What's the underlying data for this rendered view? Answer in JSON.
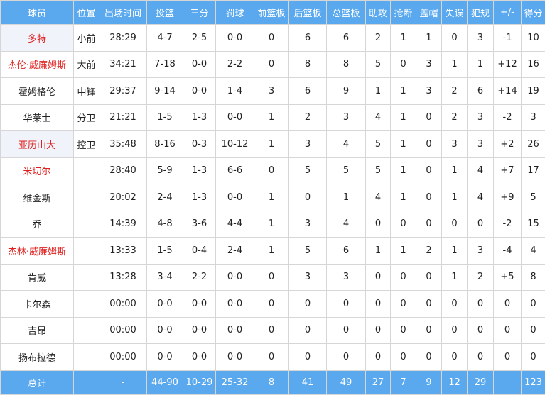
{
  "headers": [
    "球员",
    "位置",
    "出场时间",
    "投篮",
    "三分",
    "罚球",
    "前篮板",
    "后篮板",
    "总篮板",
    "助攻",
    "抢断",
    "盖帽",
    "失误",
    "犯规",
    "+/-",
    "得分"
  ],
  "players": [
    {
      "name": "多特",
      "pos": "小前",
      "min": "28:29",
      "fg": "4-7",
      "tp": "2-5",
      "ft": "0-0",
      "oreb": "0",
      "dreb": "6",
      "reb": "6",
      "ast": "2",
      "stl": "1",
      "blk": "1",
      "tov": "0",
      "pf": "3",
      "pm": "-1",
      "pts": "10",
      "red": true,
      "hl": true
    },
    {
      "name": "杰伦·威廉姆斯",
      "pos": "大前",
      "min": "34:21",
      "fg": "7-18",
      "tp": "0-0",
      "ft": "2-2",
      "oreb": "0",
      "dreb": "8",
      "reb": "8",
      "ast": "5",
      "stl": "0",
      "blk": "3",
      "tov": "1",
      "pf": "1",
      "pm": "+12",
      "pts": "16",
      "red": true,
      "hl": false
    },
    {
      "name": "霍姆格伦",
      "pos": "中锋",
      "min": "29:37",
      "fg": "9-14",
      "tp": "0-0",
      "ft": "1-4",
      "oreb": "3",
      "dreb": "6",
      "reb": "9",
      "ast": "1",
      "stl": "1",
      "blk": "3",
      "tov": "2",
      "pf": "6",
      "pm": "+14",
      "pts": "19",
      "red": false,
      "hl": false
    },
    {
      "name": "华莱士",
      "pos": "分卫",
      "min": "21:21",
      "fg": "1-5",
      "tp": "1-3",
      "ft": "0-0",
      "oreb": "1",
      "dreb": "2",
      "reb": "3",
      "ast": "4",
      "stl": "1",
      "blk": "0",
      "tov": "2",
      "pf": "3",
      "pm": "-2",
      "pts": "3",
      "red": false,
      "hl": false
    },
    {
      "name": "亚历山大",
      "pos": "控卫",
      "min": "35:48",
      "fg": "8-16",
      "tp": "0-3",
      "ft": "10-12",
      "oreb": "1",
      "dreb": "3",
      "reb": "4",
      "ast": "5",
      "stl": "1",
      "blk": "0",
      "tov": "3",
      "pf": "3",
      "pm": "+2",
      "pts": "26",
      "red": true,
      "hl": true
    },
    {
      "name": "米切尔",
      "pos": "",
      "min": "28:40",
      "fg": "5-9",
      "tp": "1-3",
      "ft": "6-6",
      "oreb": "0",
      "dreb": "5",
      "reb": "5",
      "ast": "5",
      "stl": "1",
      "blk": "0",
      "tov": "1",
      "pf": "4",
      "pm": "+7",
      "pts": "17",
      "red": true,
      "hl": false
    },
    {
      "name": "维金斯",
      "pos": "",
      "min": "20:02",
      "fg": "2-4",
      "tp": "1-3",
      "ft": "0-0",
      "oreb": "1",
      "dreb": "0",
      "reb": "1",
      "ast": "4",
      "stl": "1",
      "blk": "0",
      "tov": "1",
      "pf": "4",
      "pm": "+9",
      "pts": "5",
      "red": false,
      "hl": false
    },
    {
      "name": "乔",
      "pos": "",
      "min": "14:39",
      "fg": "4-8",
      "tp": "3-6",
      "ft": "4-4",
      "oreb": "1",
      "dreb": "3",
      "reb": "4",
      "ast": "0",
      "stl": "0",
      "blk": "0",
      "tov": "0",
      "pf": "0",
      "pm": "-2",
      "pts": "15",
      "red": false,
      "hl": false
    },
    {
      "name": "杰林·威廉姆斯",
      "pos": "",
      "min": "13:33",
      "fg": "1-5",
      "tp": "0-4",
      "ft": "2-4",
      "oreb": "1",
      "dreb": "5",
      "reb": "6",
      "ast": "1",
      "stl": "1",
      "blk": "2",
      "tov": "1",
      "pf": "3",
      "pm": "-4",
      "pts": "4",
      "red": true,
      "hl": false
    },
    {
      "name": "肯威",
      "pos": "",
      "min": "13:28",
      "fg": "3-4",
      "tp": "2-2",
      "ft": "0-0",
      "oreb": "0",
      "dreb": "3",
      "reb": "3",
      "ast": "0",
      "stl": "0",
      "blk": "0",
      "tov": "1",
      "pf": "2",
      "pm": "+5",
      "pts": "8",
      "red": false,
      "hl": false
    },
    {
      "name": "卡尔森",
      "pos": "",
      "min": "00:00",
      "fg": "0-0",
      "tp": "0-0",
      "ft": "0-0",
      "oreb": "0",
      "dreb": "0",
      "reb": "0",
      "ast": "0",
      "stl": "0",
      "blk": "0",
      "tov": "0",
      "pf": "0",
      "pm": "0",
      "pts": "0",
      "red": false,
      "hl": false
    },
    {
      "name": "吉昂",
      "pos": "",
      "min": "00:00",
      "fg": "0-0",
      "tp": "0-0",
      "ft": "0-0",
      "oreb": "0",
      "dreb": "0",
      "reb": "0",
      "ast": "0",
      "stl": "0",
      "blk": "0",
      "tov": "0",
      "pf": "0",
      "pm": "0",
      "pts": "0",
      "red": false,
      "hl": false
    },
    {
      "name": "扬布拉德",
      "pos": "",
      "min": "00:00",
      "fg": "0-0",
      "tp": "0-0",
      "ft": "0-0",
      "oreb": "0",
      "dreb": "0",
      "reb": "0",
      "ast": "0",
      "stl": "0",
      "blk": "0",
      "tov": "0",
      "pf": "0",
      "pm": "0",
      "pts": "0",
      "red": false,
      "hl": false
    }
  ],
  "totals": {
    "name": "总计",
    "pos": "",
    "min": "-",
    "fg": "44-90",
    "tp": "10-29",
    "ft": "25-32",
    "oreb": "8",
    "dreb": "41",
    "reb": "49",
    "ast": "27",
    "stl": "7",
    "blk": "9",
    "tov": "12",
    "pf": "29",
    "pm": "",
    "pts": "123"
  },
  "colors": {
    "header_bg": "#5aa9ee",
    "red_name": "#e0201e",
    "highlight_bg": "#f1f3fb"
  }
}
